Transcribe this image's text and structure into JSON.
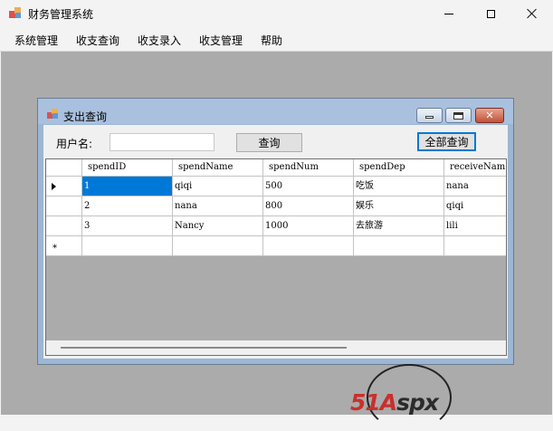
{
  "window": {
    "title": "财务管理系统"
  },
  "menu": {
    "items": [
      "系统管理",
      "收支查询",
      "收支录入",
      "收支管理",
      "帮助"
    ]
  },
  "child": {
    "title": "支出查询",
    "user_label": "用户名:",
    "user_value": "",
    "query_button": "查询",
    "all_query_button": "全部查询"
  },
  "grid": {
    "columns": [
      "spendID",
      "spendName",
      "spendNum",
      "spendDep",
      "receiveNam"
    ],
    "rows": [
      [
        "1",
        "qiqi",
        "500",
        "吃饭",
        "nana"
      ],
      [
        "2",
        "nana",
        "800",
        "娱乐",
        "qiqi"
      ],
      [
        "3",
        "Nancy",
        "1000",
        "去旅游",
        "lili"
      ]
    ],
    "selected_row": 0,
    "new_row_marker": "*"
  },
  "watermark": {
    "text_red": "51A",
    "text_dark": "spx"
  },
  "colors": {
    "selection": "#0078d7",
    "mdi_background": "#ababab",
    "child_frame": "#9cb6d4"
  }
}
